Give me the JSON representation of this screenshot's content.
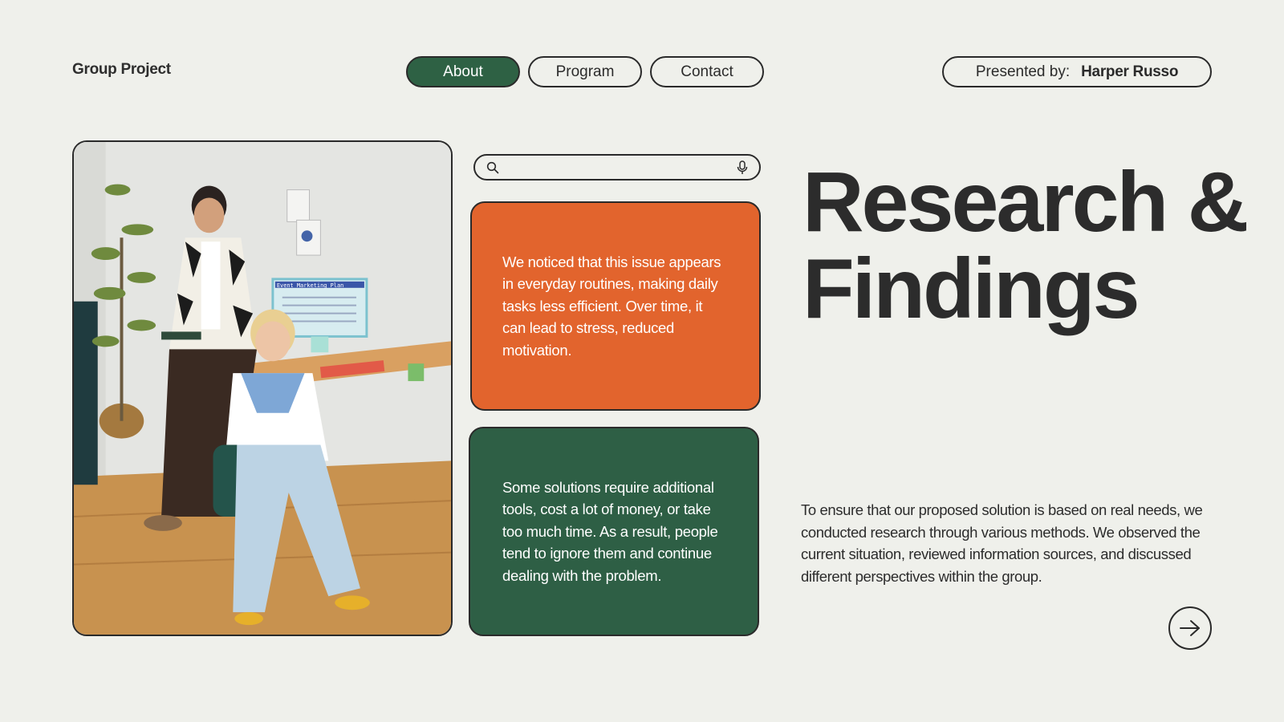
{
  "header": {
    "brand": "Group Project",
    "nav": [
      {
        "label": "About",
        "active": true
      },
      {
        "label": "Program",
        "active": false
      },
      {
        "label": "Contact",
        "active": false
      }
    ],
    "presenter_label": "Presented by:",
    "presenter_name": "Harper Russo"
  },
  "search": {
    "placeholder": "",
    "icons": [
      "search-icon",
      "microphone-icon"
    ]
  },
  "photo": {
    "monitor_text": "Event Marketing Plan"
  },
  "cards": [
    {
      "text": "We noticed that this issue appears in everyday routines, making daily tasks less efficient. Over time, it can lead to stress, reduced motivation.",
      "color": "#e2642d"
    },
    {
      "text": "Some solutions require additional tools, cost a lot of money, or take too much time. As a result, people tend to ignore them and continue dealing with the problem.",
      "color": "#2e5f45"
    }
  ],
  "main": {
    "title_line1": "Research &",
    "title_line2": "Findings",
    "description": "To ensure that our proposed solution is based on real needs, we conducted research through various methods. We observed the current situation, reviewed information sources, and discussed different perspectives within the group."
  },
  "next_icon": "arrow-right-icon",
  "colors": {
    "background": "#eff0eb",
    "accent_green": "#2e6144",
    "accent_orange": "#e2642d",
    "text_dark": "#2c2c2c"
  }
}
